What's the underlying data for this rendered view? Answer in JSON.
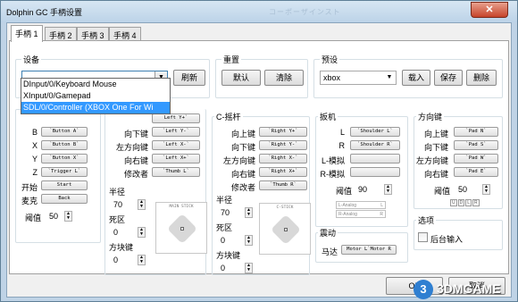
{
  "window": {
    "title": "Dolphin GC 手柄设置",
    "ghost_title": "コーポーザインスト",
    "close": "✕"
  },
  "tabs": [
    "手柄 1",
    "手柄 2",
    "手柄 3",
    "手柄 4"
  ],
  "device": {
    "title": "设备",
    "value": "",
    "refresh": "刷新",
    "options": [
      "DInput/0/Keyboard Mouse",
      "XInput/0/Gamepad",
      "SDL/0/Controller (XBOX One For Wi"
    ],
    "selected_index": 2
  },
  "reset": {
    "title": "重置",
    "default": "默认",
    "clear": "清除"
  },
  "preset": {
    "title": "预设",
    "value": "xbox",
    "load": "载入",
    "save": "保存",
    "delete": "删除"
  },
  "buttons_group": {
    "rows": [
      {
        "label": "B",
        "map": "`Button A`"
      },
      {
        "label": "X",
        "map": "`Button B`"
      },
      {
        "label": "Y",
        "map": "`Button X`"
      },
      {
        "label": "Z",
        "map": "`Trigger L`"
      },
      {
        "label": "开始",
        "map": "Start"
      },
      {
        "label": "麦克",
        "map": "Back"
      }
    ],
    "threshold_label": "阈值",
    "threshold_value": "50"
  },
  "main_stick": {
    "partial_rows": [
      {
        "map": "Left Y+`"
      },
      {
        "label": "向下键",
        "map": "`Left Y-`"
      },
      {
        "label": "左方向键",
        "map": "`Left X-`"
      },
      {
        "label": "向右键",
        "map": "`Left X+`"
      },
      {
        "label": "修改者",
        "map": "`Thumb L`"
      }
    ],
    "radius_label": "半径",
    "radius_value": "70",
    "dead_label": "死区",
    "dead_value": "0",
    "square_label": "方块键",
    "square_value": "0",
    "stick_caption": "MAIN STICK"
  },
  "c_stick": {
    "title": "C-摇杆",
    "rows": [
      {
        "label": "向上键",
        "map": "`Right Y+`"
      },
      {
        "label": "向下键",
        "map": "`Right Y-`"
      },
      {
        "label": "左方向键",
        "map": "`Right X-`"
      },
      {
        "label": "向右键",
        "map": "`Right X+`"
      },
      {
        "label": "修改者",
        "map": "`Thumb R`"
      }
    ],
    "radius_label": "半径",
    "radius_value": "70",
    "dead_label": "死区",
    "dead_value": "0",
    "square_label": "方块键",
    "square_value": "0",
    "stick_caption": "C-STICK"
  },
  "triggers": {
    "title": "扳机",
    "rows": [
      {
        "label": "L",
        "map": "`Shoulder L`"
      },
      {
        "label": "R",
        "map": "`Shoulder R`"
      },
      {
        "label": "L-模拟",
        "map": ""
      },
      {
        "label": "R-模拟",
        "map": ""
      }
    ],
    "threshold_label": "阈值",
    "threshold_value": "90",
    "analog_l": "L-Analog",
    "analog_r": "R-Analog",
    "analog_l_tag": "L",
    "analog_r_tag": "R"
  },
  "dpad": {
    "title": "方向键",
    "rows": [
      {
        "label": "向上键",
        "map": "`Pad N`"
      },
      {
        "label": "向下键",
        "map": "`Pad S`"
      },
      {
        "label": "左方向键",
        "map": "`Pad W`"
      },
      {
        "label": "向右键",
        "map": "`Pad E`"
      }
    ],
    "threshold_label": "阈值",
    "threshold_value": "50",
    "lights": [
      "U",
      "D",
      "L",
      "R"
    ]
  },
  "rumble": {
    "title": "震动",
    "label": "马达",
    "map": "Motor L`Motor R"
  },
  "options": {
    "title": "选项",
    "background_input": "后台输入"
  },
  "footer": {
    "ok": "OK",
    "cancel": "取消"
  },
  "watermark": {
    "logo": "3",
    "text": "3DMGAME"
  }
}
